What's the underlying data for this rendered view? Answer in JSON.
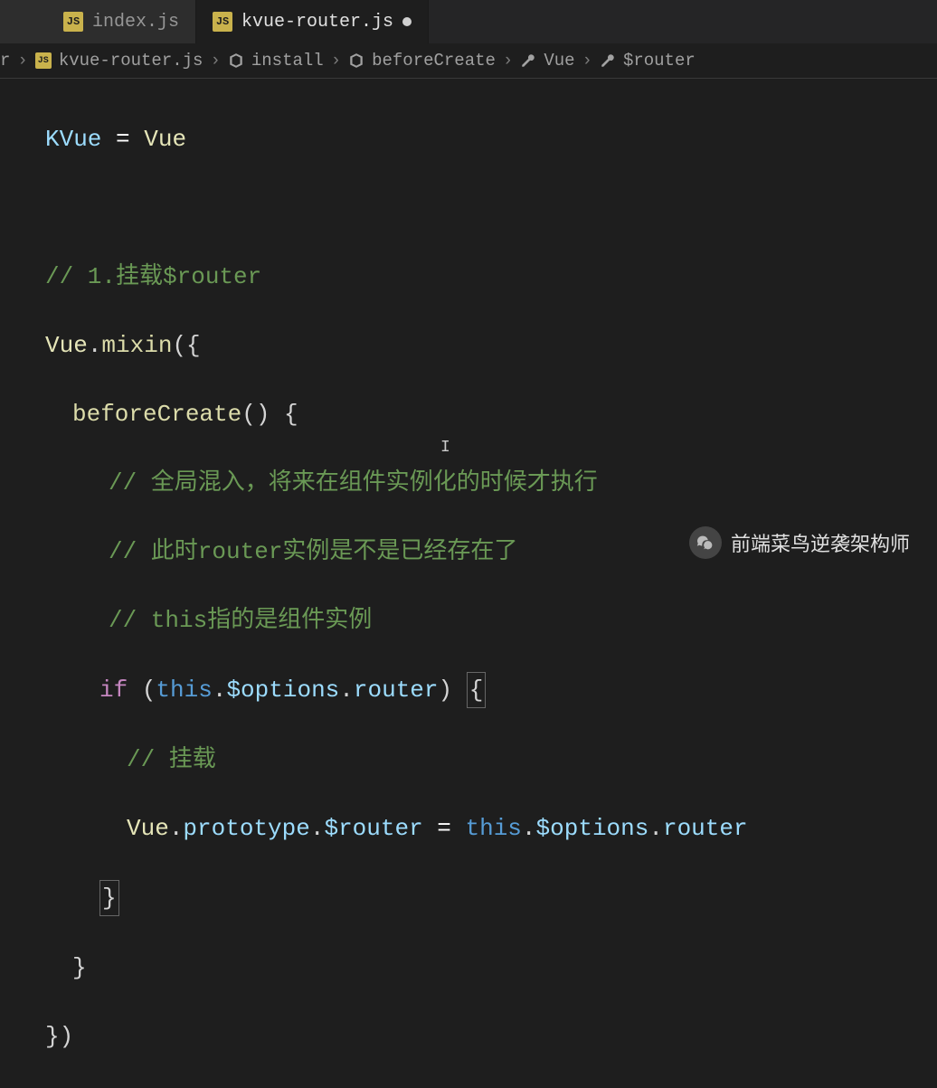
{
  "tabs": [
    {
      "icon": "JS",
      "label": "index.js",
      "active": false
    },
    {
      "icon": "JS",
      "label": "kvue-router.js",
      "active": true,
      "modified": true
    }
  ],
  "breadcrumb": {
    "truncatedSuffix": "r",
    "items": [
      {
        "icon": "js",
        "label": "kvue-router.js"
      },
      {
        "icon": "cube",
        "label": "install"
      },
      {
        "icon": "cube",
        "label": "beforeCreate"
      },
      {
        "icon": "wrench",
        "label": "Vue"
      },
      {
        "icon": "wrench",
        "label": "$router"
      }
    ]
  },
  "code": {
    "l1_var": "KVue",
    "l1_eq": " = ",
    "l1_val": "Vue",
    "c1": "// 1.挂载$router",
    "l3_obj": "Vue",
    "l3_dot": ".",
    "l3_fn": "mixin",
    "l3_open": "({",
    "l4_method": "beforeCreate",
    "l4_paren": "() ",
    "l4_brace": "{",
    "c2": "// 全局混入，将来在组件实例化的时候才执行",
    "c3": "// 此时router实例是不是已经存在了",
    "c4": "// this指的是组件实例",
    "l8_if": "if ",
    "l8_lp": "(",
    "l8_this": "this",
    "l8_dot1": ".",
    "l8_opt": "$options",
    "l8_dot2": ".",
    "l8_router": "router",
    "l8_rp": ") ",
    "l8_brace": "{",
    "c5": "// 挂载",
    "l10_vue": "Vue",
    "l10_dot1": ".",
    "l10_proto": "prototype",
    "l10_dot2": ".",
    "l10_router": "$router",
    "l10_eq": " = ",
    "l10_this": "this",
    "l10_dot3": ".",
    "l10_opt": "$options",
    "l10_dot4": ".",
    "l10_router2": "router",
    "l11_brace": "}",
    "l12_brace": "}",
    "l13_close": "})"
  },
  "watermark": {
    "text": "前端菜鸟逆袭架构师"
  }
}
